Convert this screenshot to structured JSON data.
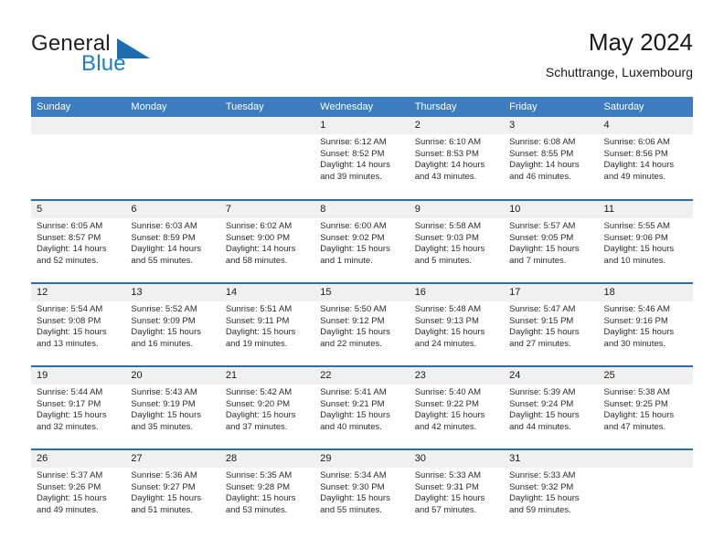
{
  "logo": {
    "word_one": "General",
    "word_two": "Blue",
    "triangle_icon": "triangle-icon",
    "brand_blue": "#1d7fc3",
    "triangle_blue": "#1b6cb0"
  },
  "header": {
    "title": "May 2024",
    "subtitle": "Schuttrange, Luxembourg"
  },
  "calendar": {
    "header_bg": "#3b7dbe",
    "row_divider": "#2a6ead",
    "daynum_bg": "#f0f0f0",
    "weekdays": [
      "Sunday",
      "Monday",
      "Tuesday",
      "Wednesday",
      "Thursday",
      "Friday",
      "Saturday"
    ],
    "weeks": [
      [
        {
          "day": "",
          "empty": true
        },
        {
          "day": "",
          "empty": true
        },
        {
          "day": "",
          "empty": true
        },
        {
          "day": "1",
          "sunrise": "Sunrise: 6:12 AM",
          "sunset": "Sunset: 8:52 PM",
          "daylight_1": "Daylight: 14 hours",
          "daylight_2": "and 39 minutes."
        },
        {
          "day": "2",
          "sunrise": "Sunrise: 6:10 AM",
          "sunset": "Sunset: 8:53 PM",
          "daylight_1": "Daylight: 14 hours",
          "daylight_2": "and 43 minutes."
        },
        {
          "day": "3",
          "sunrise": "Sunrise: 6:08 AM",
          "sunset": "Sunset: 8:55 PM",
          "daylight_1": "Daylight: 14 hours",
          "daylight_2": "and 46 minutes."
        },
        {
          "day": "4",
          "sunrise": "Sunrise: 6:06 AM",
          "sunset": "Sunset: 8:56 PM",
          "daylight_1": "Daylight: 14 hours",
          "daylight_2": "and 49 minutes."
        }
      ],
      [
        {
          "day": "5",
          "sunrise": "Sunrise: 6:05 AM",
          "sunset": "Sunset: 8:57 PM",
          "daylight_1": "Daylight: 14 hours",
          "daylight_2": "and 52 minutes."
        },
        {
          "day": "6",
          "sunrise": "Sunrise: 6:03 AM",
          "sunset": "Sunset: 8:59 PM",
          "daylight_1": "Daylight: 14 hours",
          "daylight_2": "and 55 minutes."
        },
        {
          "day": "7",
          "sunrise": "Sunrise: 6:02 AM",
          "sunset": "Sunset: 9:00 PM",
          "daylight_1": "Daylight: 14 hours",
          "daylight_2": "and 58 minutes."
        },
        {
          "day": "8",
          "sunrise": "Sunrise: 6:00 AM",
          "sunset": "Sunset: 9:02 PM",
          "daylight_1": "Daylight: 15 hours",
          "daylight_2": "and 1 minute."
        },
        {
          "day": "9",
          "sunrise": "Sunrise: 5:58 AM",
          "sunset": "Sunset: 9:03 PM",
          "daylight_1": "Daylight: 15 hours",
          "daylight_2": "and 5 minutes."
        },
        {
          "day": "10",
          "sunrise": "Sunrise: 5:57 AM",
          "sunset": "Sunset: 9:05 PM",
          "daylight_1": "Daylight: 15 hours",
          "daylight_2": "and 7 minutes."
        },
        {
          "day": "11",
          "sunrise": "Sunrise: 5:55 AM",
          "sunset": "Sunset: 9:06 PM",
          "daylight_1": "Daylight: 15 hours",
          "daylight_2": "and 10 minutes."
        }
      ],
      [
        {
          "day": "12",
          "sunrise": "Sunrise: 5:54 AM",
          "sunset": "Sunset: 9:08 PM",
          "daylight_1": "Daylight: 15 hours",
          "daylight_2": "and 13 minutes."
        },
        {
          "day": "13",
          "sunrise": "Sunrise: 5:52 AM",
          "sunset": "Sunset: 9:09 PM",
          "daylight_1": "Daylight: 15 hours",
          "daylight_2": "and 16 minutes."
        },
        {
          "day": "14",
          "sunrise": "Sunrise: 5:51 AM",
          "sunset": "Sunset: 9:11 PM",
          "daylight_1": "Daylight: 15 hours",
          "daylight_2": "and 19 minutes."
        },
        {
          "day": "15",
          "sunrise": "Sunrise: 5:50 AM",
          "sunset": "Sunset: 9:12 PM",
          "daylight_1": "Daylight: 15 hours",
          "daylight_2": "and 22 minutes."
        },
        {
          "day": "16",
          "sunrise": "Sunrise: 5:48 AM",
          "sunset": "Sunset: 9:13 PM",
          "daylight_1": "Daylight: 15 hours",
          "daylight_2": "and 24 minutes."
        },
        {
          "day": "17",
          "sunrise": "Sunrise: 5:47 AM",
          "sunset": "Sunset: 9:15 PM",
          "daylight_1": "Daylight: 15 hours",
          "daylight_2": "and 27 minutes."
        },
        {
          "day": "18",
          "sunrise": "Sunrise: 5:46 AM",
          "sunset": "Sunset: 9:16 PM",
          "daylight_1": "Daylight: 15 hours",
          "daylight_2": "and 30 minutes."
        }
      ],
      [
        {
          "day": "19",
          "sunrise": "Sunrise: 5:44 AM",
          "sunset": "Sunset: 9:17 PM",
          "daylight_1": "Daylight: 15 hours",
          "daylight_2": "and 32 minutes."
        },
        {
          "day": "20",
          "sunrise": "Sunrise: 5:43 AM",
          "sunset": "Sunset: 9:19 PM",
          "daylight_1": "Daylight: 15 hours",
          "daylight_2": "and 35 minutes."
        },
        {
          "day": "21",
          "sunrise": "Sunrise: 5:42 AM",
          "sunset": "Sunset: 9:20 PM",
          "daylight_1": "Daylight: 15 hours",
          "daylight_2": "and 37 minutes."
        },
        {
          "day": "22",
          "sunrise": "Sunrise: 5:41 AM",
          "sunset": "Sunset: 9:21 PM",
          "daylight_1": "Daylight: 15 hours",
          "daylight_2": "and 40 minutes."
        },
        {
          "day": "23",
          "sunrise": "Sunrise: 5:40 AM",
          "sunset": "Sunset: 9:22 PM",
          "daylight_1": "Daylight: 15 hours",
          "daylight_2": "and 42 minutes."
        },
        {
          "day": "24",
          "sunrise": "Sunrise: 5:39 AM",
          "sunset": "Sunset: 9:24 PM",
          "daylight_1": "Daylight: 15 hours",
          "daylight_2": "and 44 minutes."
        },
        {
          "day": "25",
          "sunrise": "Sunrise: 5:38 AM",
          "sunset": "Sunset: 9:25 PM",
          "daylight_1": "Daylight: 15 hours",
          "daylight_2": "and 47 minutes."
        }
      ],
      [
        {
          "day": "26",
          "sunrise": "Sunrise: 5:37 AM",
          "sunset": "Sunset: 9:26 PM",
          "daylight_1": "Daylight: 15 hours",
          "daylight_2": "and 49 minutes."
        },
        {
          "day": "27",
          "sunrise": "Sunrise: 5:36 AM",
          "sunset": "Sunset: 9:27 PM",
          "daylight_1": "Daylight: 15 hours",
          "daylight_2": "and 51 minutes."
        },
        {
          "day": "28",
          "sunrise": "Sunrise: 5:35 AM",
          "sunset": "Sunset: 9:28 PM",
          "daylight_1": "Daylight: 15 hours",
          "daylight_2": "and 53 minutes."
        },
        {
          "day": "29",
          "sunrise": "Sunrise: 5:34 AM",
          "sunset": "Sunset: 9:30 PM",
          "daylight_1": "Daylight: 15 hours",
          "daylight_2": "and 55 minutes."
        },
        {
          "day": "30",
          "sunrise": "Sunrise: 5:33 AM",
          "sunset": "Sunset: 9:31 PM",
          "daylight_1": "Daylight: 15 hours",
          "daylight_2": "and 57 minutes."
        },
        {
          "day": "31",
          "sunrise": "Sunrise: 5:33 AM",
          "sunset": "Sunset: 9:32 PM",
          "daylight_1": "Daylight: 15 hours",
          "daylight_2": "and 59 minutes."
        },
        {
          "day": "",
          "empty": true
        }
      ]
    ]
  }
}
